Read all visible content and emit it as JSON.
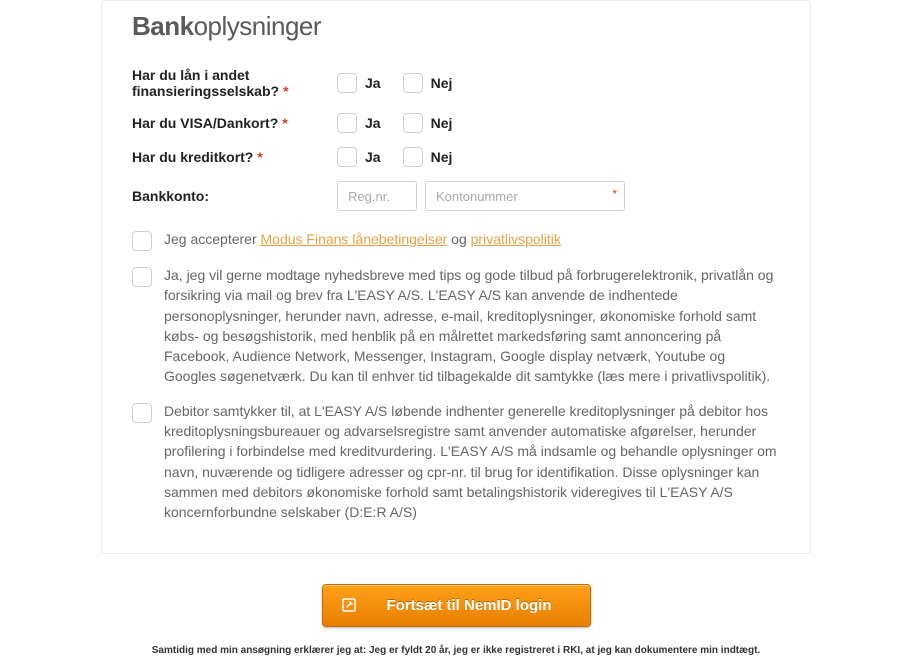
{
  "title_bold": "Bank",
  "title_rest": "oplysninger",
  "questions": [
    {
      "label": "Har du lån i andet finansieringsselskab?",
      "yes": "Ja",
      "no": "Nej"
    },
    {
      "label": "Har du VISA/Dankort?",
      "yes": "Ja",
      "no": "Nej"
    },
    {
      "label": "Har du kreditkort?",
      "yes": "Ja",
      "no": "Nej"
    }
  ],
  "bank_account_label": "Bankkonto:",
  "regnr_placeholder": "Reg.nr.",
  "kontonr_placeholder": "Kontonummer",
  "accept_prefix": "Jeg accepterer ",
  "accept_link1": "Modus Finans lånebetingelser",
  "accept_mid": " og ",
  "accept_link2": "privatlivspolitik",
  "newsletter_text": "Ja, jeg vil gerne modtage nyhedsbreve med tips og gode tilbud på forbrugerelektronik, privatlån og forsikring via mail og brev fra L'EASY A/S. L'EASY A/S kan anvende de indhentede personoplysninger, herunder navn, adresse, e-mail, kreditoplysninger, økonomiske forhold samt købs- og besøgshistorik, med henblik på en målrettet markedsføring samt annoncering på Facebook, Audience Network, Messenger, Instagram, Google display netværk, Youtube og Googles søgenetværk. Du kan til enhver tid tilbagekalde dit samtykke (læs mere i privatlivspolitik).",
  "debtor_text": "Debitor samtykker til, at L'EASY A/S løbende indhenter generelle kreditoplysninger på debitor hos kreditoplysningsbureauer og advarselsregistre samt anvender automatiske afgørelser, herunder profilering i forbindelse med kreditvurdering. L'EASY A/S må indsamle og behandle oplysninger om navn, nuværende og tidligere adresser og cpr-nr. til brug for identifikation. Disse oplysninger kan sammen med debitors økonomiske forhold samt betalingshistorik videregives til L'EASY A/S koncernforbundne selskaber (D:E:R A/S)",
  "submit_label": "Fortsæt til NemID login",
  "disclaimer": "Samtidig med min ansøgning erklærer jeg at: Jeg er fyldt 20 år, jeg er ikke registreret i RKI, at jeg kan dokumentere min indtægt."
}
